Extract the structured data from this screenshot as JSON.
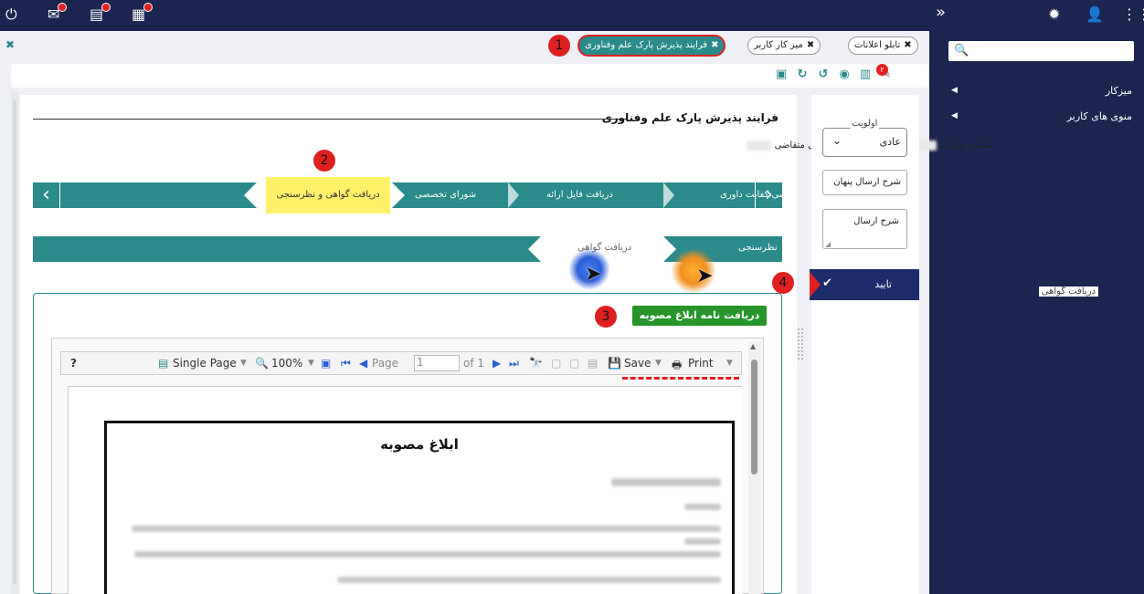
{
  "topbar": {
    "left_icons": [
      "power-icon",
      "mail-icon",
      "document-icon",
      "calendar-icon"
    ],
    "right_icons": [
      "chevrons-right-icon",
      "gear-icon",
      "user-icon",
      "grid-icon"
    ]
  },
  "sidebar": {
    "search_placeholder": "",
    "items": [
      {
        "label": "میزکار"
      },
      {
        "label": "منوی های کاربر"
      }
    ]
  },
  "tabs": [
    {
      "label": "تابلو اعلانات"
    },
    {
      "label": "میز کار کاربر"
    },
    {
      "label": "فرایند پذیرش پارک علم وفناوری"
    }
  ],
  "toolbar": {
    "badge_count": "۲"
  },
  "form": {
    "title": "فرایند پذیرش پارک علم وفناوری",
    "applicant_label": "نام و نام خانوادگی متقاضی",
    "process_number_label": "شماره فرآیند:"
  },
  "steps": [
    {
      "label": "سی کفایت داوری"
    },
    {
      "label": "دریافت فایل ارائه"
    },
    {
      "label": "شورای تخصصی"
    },
    {
      "label": "دریافت گواهی و نظرسنجی"
    }
  ],
  "subtabs": [
    {
      "label": "نظرسنجی"
    },
    {
      "label": "دریافت گواهی"
    }
  ],
  "fieldset_legend": "دریافت گواهی",
  "download_button": "دریافت نامه ابلاغ مصوبه",
  "viewer": {
    "help": "?",
    "single_page": "Single Page",
    "zoom": "100%",
    "page_label": "Page",
    "page_value": "1",
    "of_label": "of 1",
    "save": "Save",
    "print": "Print"
  },
  "document": {
    "title": "ابلاغ مصوبه"
  },
  "right_panel": {
    "priority_legend": "اولویت",
    "priority_value": "عادی",
    "hidden_note_placeholder": "شرح ارسال پنهان",
    "note_placeholder": "شرح ارسال",
    "confirm_label": "تایید"
  },
  "annotations": [
    "1",
    "2",
    "3",
    "4"
  ],
  "colors": {
    "navy": "#1b2550",
    "teal": "#2b8a8a",
    "green": "#27952a",
    "highlight": "#fff26a",
    "annotation_red": "#e02020"
  }
}
